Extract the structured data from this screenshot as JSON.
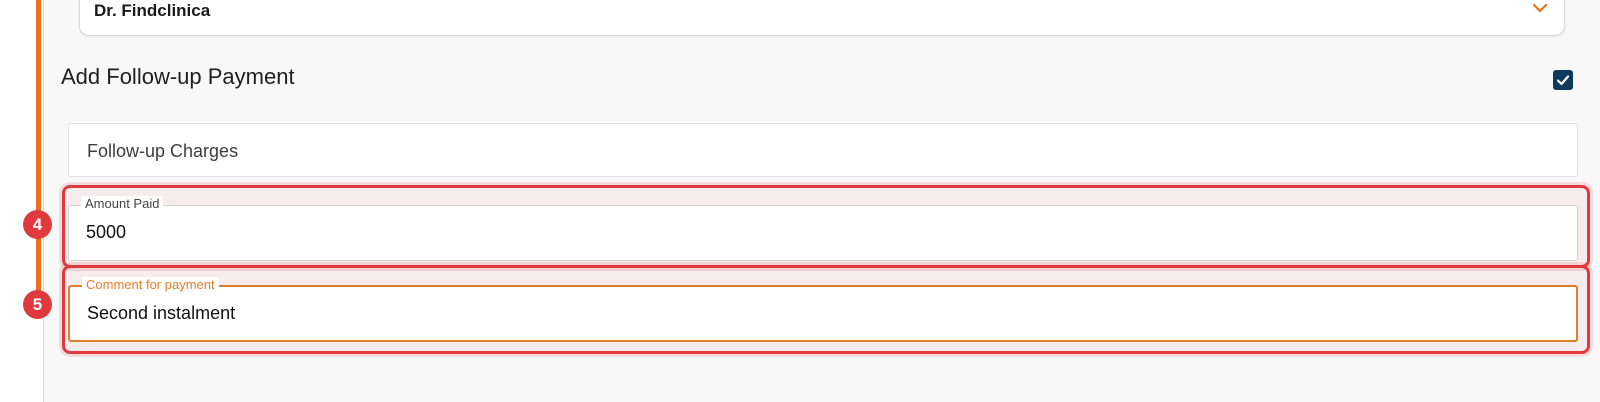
{
  "doctor_select": {
    "value": "Dr. Findclinica"
  },
  "follow_up": {
    "title": "Add Follow-up Payment",
    "checked": true,
    "charges_label": "Follow-up Charges"
  },
  "fields": {
    "amount_paid": {
      "label": "Amount Paid",
      "value": "5000"
    },
    "comment": {
      "label": "Comment for payment",
      "value": "Second instalment"
    }
  },
  "steps": {
    "step_4": "4",
    "step_5": "5"
  },
  "colors": {
    "accent_orange": "#ee7016",
    "highlight_red": "#e03a3e",
    "checkbox_navy": "#0e3a5c"
  },
  "icons": {
    "select_chevron": "chevron-down-icon",
    "checkbox_check": "check-icon"
  }
}
